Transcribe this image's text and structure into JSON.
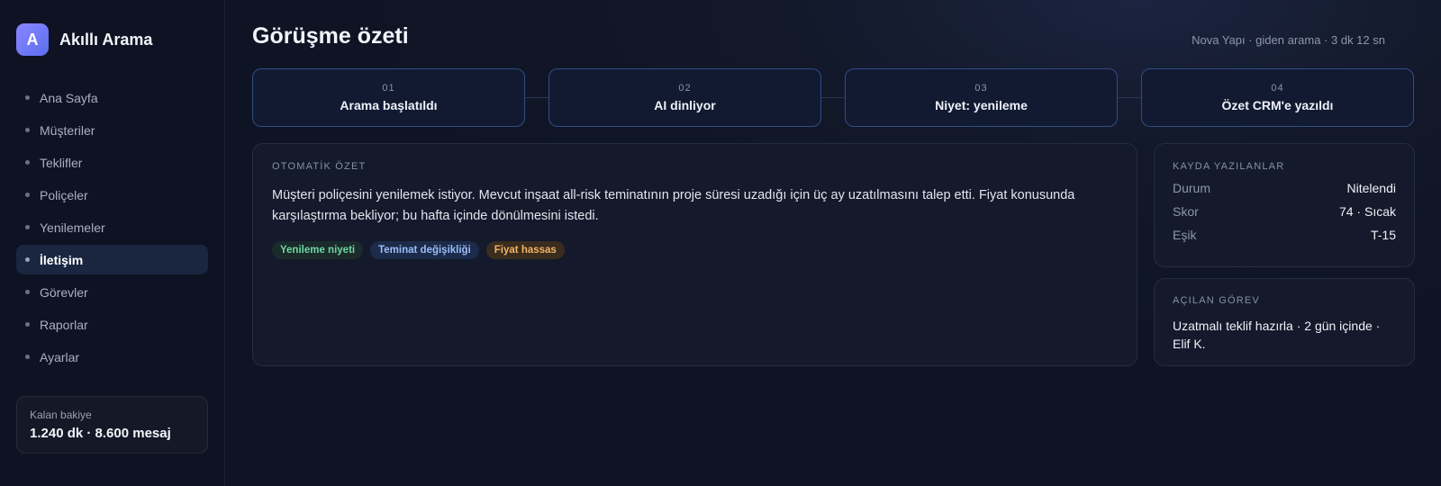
{
  "brand": {
    "logo_letter": "A",
    "name": "Akıllı Arama",
    "accent": "#7b7cff"
  },
  "sidebar": {
    "items": [
      {
        "label": "Ana Sayfa",
        "active": false
      },
      {
        "label": "Müşteriler",
        "active": false
      },
      {
        "label": "Teklifler",
        "active": false
      },
      {
        "label": "Poliçeler",
        "active": false
      },
      {
        "label": "Yenilemeler",
        "active": false
      },
      {
        "label": "İletişim",
        "active": true
      },
      {
        "label": "Görevler",
        "active": false
      },
      {
        "label": "Raporlar",
        "active": false
      },
      {
        "label": "Ayarlar",
        "active": false
      }
    ],
    "balance": {
      "label": "Kalan bakiye",
      "value": "1.240 dk · 8.600 mesaj"
    }
  },
  "header": {
    "title": "Görüşme özeti",
    "meta": "Nova Yapı · giden arama · 3 dk 12 sn"
  },
  "steps": [
    {
      "num": "01",
      "label": "Arama başlatıldı"
    },
    {
      "num": "02",
      "label": "AI dinliyor"
    },
    {
      "num": "03",
      "label": "Niyet: yenileme"
    },
    {
      "num": "04",
      "label": "Özet CRM'e yazıldı"
    }
  ],
  "summary": {
    "label": "OTOMATİK ÖZET",
    "text": "Müşteri poliçesini yenilemek istiyor. Mevcut inşaat all-risk teminatının proje süresi uzadığı için üç ay uzatılmasını talep etti. Fiyat konusunda karşılaştırma bekliyor; bu hafta içinde dönülmesini istedi.",
    "tags": [
      {
        "label": "Yenileme niyeti",
        "color": "#6fd6a3"
      },
      {
        "label": "Teminat değişikliği",
        "color": "#9bbcf5"
      },
      {
        "label": "Fiyat hassas",
        "color": "#f2b366"
      }
    ]
  },
  "records": {
    "label": "KAYDA YAZILANLAR",
    "rows": [
      {
        "key": "Durum",
        "value": "Nitelendi"
      },
      {
        "key": "Skor",
        "value": "74 · Sıcak"
      },
      {
        "key": "Eşik",
        "value": "T-15"
      }
    ]
  },
  "task": {
    "label": "AÇILAN GÖREV",
    "text": "Uzatmalı teklif hazırla · 2 gün içinde · Elif K."
  }
}
